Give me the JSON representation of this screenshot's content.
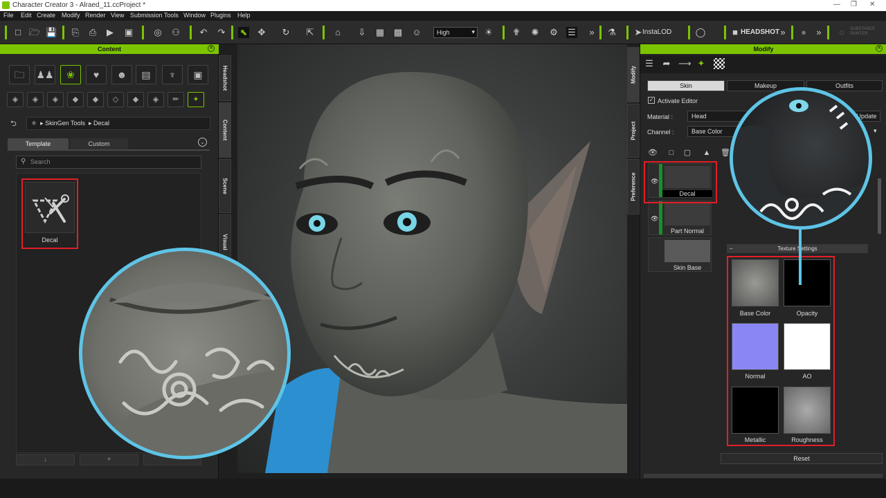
{
  "window": {
    "title": "Character Creator 3 - Alraed_11.ccProject *"
  },
  "menu": [
    "File",
    "Edit",
    "Create",
    "Modify",
    "Render",
    "View",
    "Submission Tools",
    "Window",
    "Plugins",
    "Help"
  ],
  "toolbar": {
    "quality": "High",
    "instalod": "InstaLOD",
    "headshot": "HEADSHOT",
    "substance": "SUBSTANCE PAINTER"
  },
  "left_panel": {
    "title": "Content",
    "breadcrumb": {
      "segment1": "SkinGen Tools",
      "segment2": "Decal"
    },
    "tabs": {
      "template": "Template",
      "custom": "Custom"
    },
    "search_placeholder": "Search",
    "item": {
      "label": "Decal"
    }
  },
  "left_side_tabs": {
    "headshot": "Headshot",
    "content": "Content",
    "scene": "Scene",
    "visual": "Visual"
  },
  "right_side_tabs": {
    "modify": "Modify",
    "project": "Project",
    "preference": "Preference"
  },
  "right_panel": {
    "title": "Modify",
    "tabs": {
      "skin": "Skin",
      "makeup": "Makeup",
      "outfits": "Outfits"
    },
    "activate_editor": "Activate Editor",
    "material_label": "Material :",
    "material_value": "Head",
    "update_label": "Update",
    "channel_label": "Channel :",
    "channel_value": "Base Color",
    "layers": [
      {
        "name": "Decal"
      },
      {
        "name": "Part Normal"
      },
      {
        "name": "Skin Base"
      }
    ],
    "texture_settings": "Texture Settings",
    "textures": [
      {
        "name": "Base Color"
      },
      {
        "name": "Opacity"
      },
      {
        "name": "Normal"
      },
      {
        "name": "AO"
      },
      {
        "name": "Metallic"
      },
      {
        "name": "Roughness"
      }
    ],
    "reset": "Reset"
  },
  "colors": {
    "accent": "#7cc400",
    "highlight": "#e41e26",
    "magnifier": "#5ec4e6",
    "layer_bar": "#198f2a"
  }
}
